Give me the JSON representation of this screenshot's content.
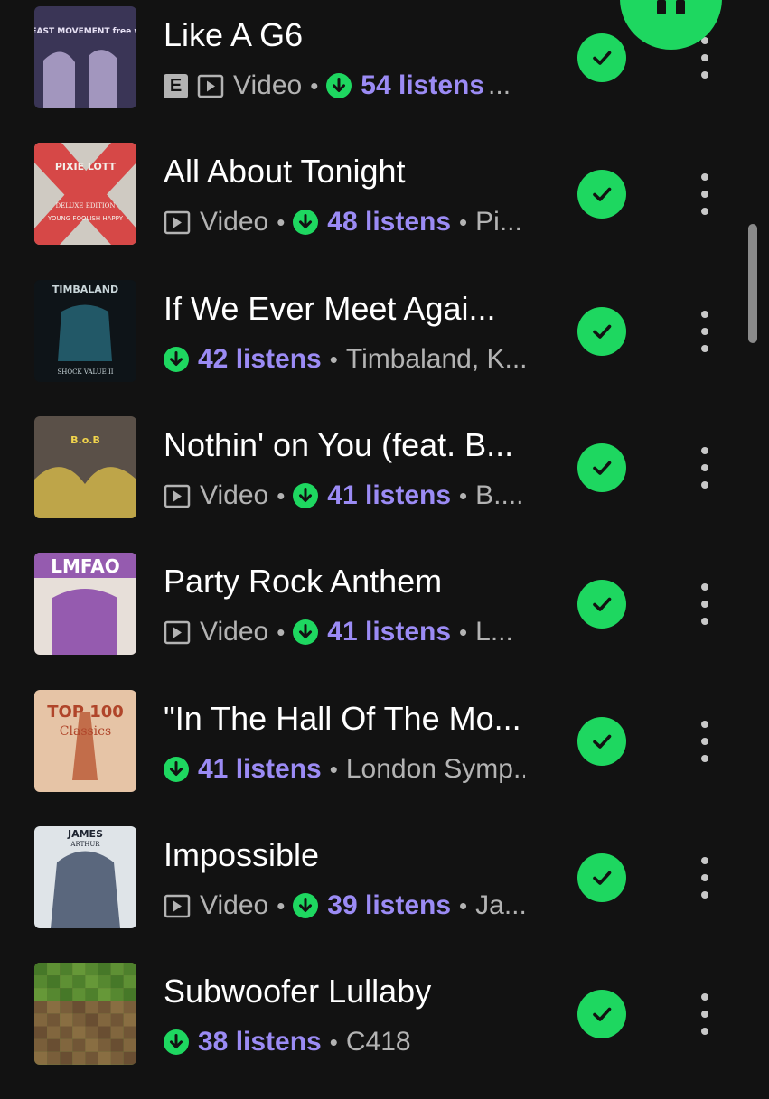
{
  "tracks": [
    {
      "title": "Like A G6",
      "explicit_label": "E",
      "type_label": "Video",
      "listens": "54 listens",
      "artist": "...",
      "downloaded": true,
      "art": {
        "bg": "#3a3556",
        "accent": "#c6b7e2",
        "text": "FAR EAST MOVEMENT free wired",
        "text_color": "#e8e2f5"
      }
    },
    {
      "title": "All About Tonight",
      "type_label": "Video",
      "listens": "48 listens",
      "artist": "Pi...",
      "downloaded": true,
      "art": {
        "bg": "#cfcac2",
        "accent": "#d63a3a",
        "text": "PIXIE LOTT",
        "subtext": "DELUXE EDITION",
        "subtext2": "YOUNG FOOLISH HAPPY",
        "text_color": "#f4f0ea"
      }
    },
    {
      "title": "If We Ever Meet Agai...",
      "listens": "42 listens",
      "artist": "Timbaland, K...",
      "downloaded": true,
      "art": {
        "bg": "#0e1418",
        "accent": "#2a6f82",
        "text": "TIMBALAND",
        "subtext": "SHOCK VALUE II",
        "text_color": "#c9d6da"
      }
    },
    {
      "title": "Nothin' on You (feat. B...",
      "type_label": "Video",
      "listens": "41 listens",
      "artist": "B....",
      "downloaded": true,
      "art": {
        "bg": "#5a5048",
        "accent": "#e0c24a",
        "text": "B.o.B",
        "text_color": "#f2d54c"
      }
    },
    {
      "title": "Party Rock Anthem",
      "type_label": "Video",
      "listens": "41 listens",
      "artist": "L...",
      "downloaded": true,
      "art": {
        "bg": "#e7dfd9",
        "accent": "#7a2fa0",
        "text": "LMFAO",
        "text_color": "#ffffff"
      }
    },
    {
      "title": "\"In The Hall Of The Mo...",
      "listens": "41 listens",
      "artist": "London Symp...",
      "downloaded": true,
      "art": {
        "bg": "#e6c4a6",
        "accent": "#b5502b",
        "text": "TOP 100",
        "subtext": "Classics",
        "text_color": "#b0452a"
      }
    },
    {
      "title": "Impossible",
      "type_label": "Video",
      "listens": "39 listens",
      "artist": "Ja...",
      "downloaded": true,
      "art": {
        "bg": "#dfe4e8",
        "accent": "#2d3e5a",
        "text": "JAMES",
        "subtext": "ARTHUR",
        "text_color": "#1e2430"
      }
    },
    {
      "title": "Subwoofer Lullaby",
      "listens": "38 listens",
      "artist": "C418",
      "downloaded": true,
      "art": {
        "bg": "#5b8f3a",
        "accent": "#7b5a3a",
        "text": "",
        "text_color": "#ffffff"
      }
    }
  ],
  "meta_separator": "•",
  "icons": {
    "explicit": "explicit-badge-icon",
    "video": "video-icon",
    "downloaded": "download-arrow-icon",
    "in_library": "check-icon",
    "more": "more-vertical-icon",
    "playback": "pause-icon"
  },
  "colors": {
    "background": "#121212",
    "accent_green": "#1ed760",
    "listens_purple": "#9b8bf4",
    "secondary_text": "#b3b3b3",
    "primary_text": "#ffffff"
  }
}
